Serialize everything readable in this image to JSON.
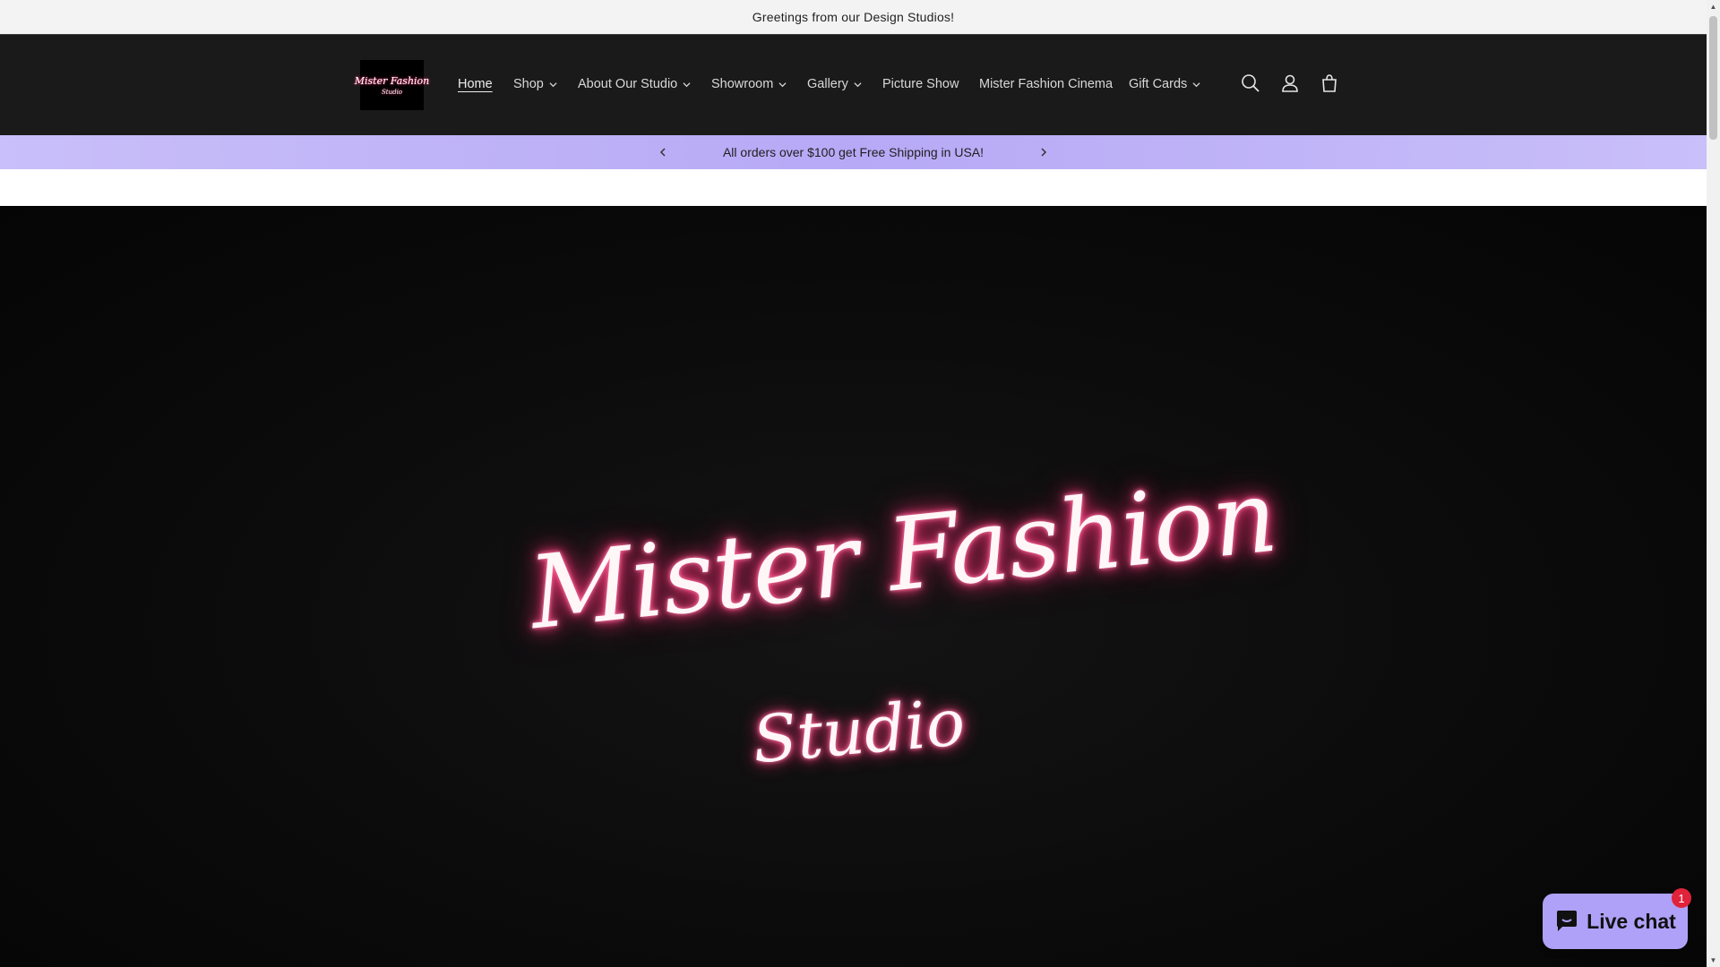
{
  "announcement": {
    "text": "Greetings from our Design Studios!"
  },
  "header": {
    "logo": {
      "line1": "Mister Fashion",
      "line2": "Studio"
    },
    "nav": [
      {
        "label": "Home",
        "dropdown": false,
        "active": true
      },
      {
        "label": "Shop",
        "dropdown": true
      },
      {
        "label": "About Our Studio",
        "dropdown": true
      },
      {
        "label": "Showroom",
        "dropdown": true
      },
      {
        "label": "Gallery",
        "dropdown": true
      },
      {
        "label": "Picture Show",
        "dropdown": false
      },
      {
        "label": "Mister Fashion Cinema",
        "dropdown": false
      },
      {
        "label": "Gift Cards",
        "dropdown": true
      }
    ],
    "icons": [
      "search-icon",
      "account-icon",
      "cart-icon"
    ]
  },
  "shipping_bar": {
    "text": "All orders over $100 get Free Shipping in USA!"
  },
  "hero": {
    "title": "Mister Fashion",
    "subtitle": "Studio"
  },
  "live_chat": {
    "label": "Live chat",
    "badge": "1"
  },
  "colors": {
    "header_bg": "#1a1a1a",
    "shipping_bar": "#b7a9f6",
    "neon_pink": "#ff2d74",
    "chat_button": "#aea1f7",
    "badge_red": "#e0223b"
  }
}
